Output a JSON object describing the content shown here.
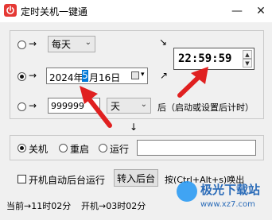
{
  "window": {
    "title": "定时关机一键通"
  },
  "titlebar_buttons": {
    "minimize": "—",
    "close": "✕"
  },
  "schedule": {
    "daily": {
      "arrow": "→",
      "repeat_value": "每天"
    },
    "date": {
      "arrow": "→",
      "date_year": "2024年",
      "date_month_highlight": "5",
      "date_rest": "月16日"
    },
    "countdown": {
      "arrow": "→",
      "amount": "999999",
      "unit": "天",
      "suffix": "后（启动或设置后计时）"
    },
    "time": {
      "value": "22:59:59"
    },
    "diag_arrows": {
      "up": "↘",
      "down": "↗"
    },
    "down_arrow": "↓"
  },
  "action": {
    "shutdown": "关机",
    "restart": "重启",
    "run": "运行",
    "run_path": ""
  },
  "background": {
    "autostart_label": "开机自动后台运行",
    "to_background_button": "转入后台",
    "hotkey_text": "按(Ctrl+Alt+s)唤出"
  },
  "status": {
    "current": "当前→11时02分",
    "boot": "开机→03时02分"
  },
  "watermark": {
    "brand": "极光下载站",
    "url": "www.xz7.com"
  },
  "colors": {
    "accent_red": "#e02020",
    "selection_blue": "#0078d7"
  }
}
